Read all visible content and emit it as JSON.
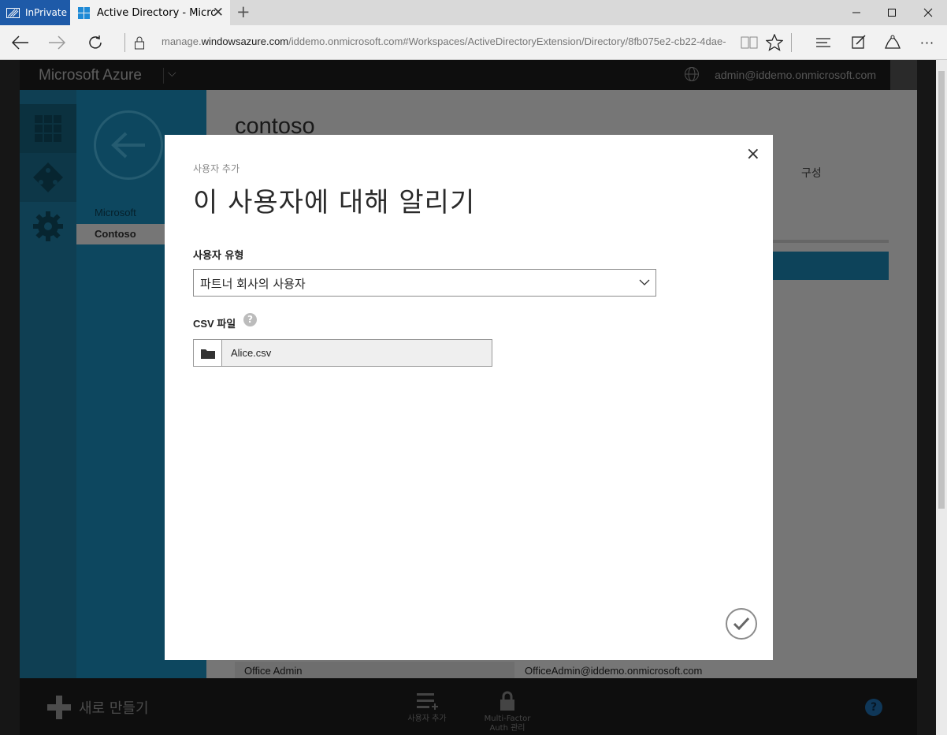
{
  "browser": {
    "inprivate_label": "InPrivate",
    "tab_title": "Active Directory - Micro...",
    "url_prefix": "manage.",
    "url_domain": "windowsazure.com",
    "url_rest": "/iddemo.onmicrosoft.com#Workspaces/ActiveDirectoryExtension/Directory/8fb075e2-cb22-4dae-",
    "new_tab": "+",
    "more": "···"
  },
  "portal": {
    "brand": "Microsoft Azure",
    "user_email": "admin@iddemo.onmicrosoft.com",
    "side_items": [
      "Microsoft",
      "Contoso"
    ],
    "content_title": "contoso",
    "content_tab": "구성",
    "row": {
      "name": "Office Admin",
      "email": "OfficeAdmin@iddemo.onmicrosoft.com"
    },
    "new_button": "새로 만들기",
    "commands": [
      {
        "label": "사용자 추가"
      },
      {
        "label": "Multi-Factor Auth 관리"
      }
    ],
    "help": "?"
  },
  "dialog": {
    "subtitle": "사용자 추가",
    "title": "이 사용자에 대해 알리기",
    "user_type_label": "사용자 유형",
    "user_type_value": "파트너 회사의 사용자",
    "csv_label_prefix": "CSV ",
    "csv_label_suffix": "파일",
    "help": "?",
    "file_name": "Alice.csv",
    "close": "×"
  }
}
